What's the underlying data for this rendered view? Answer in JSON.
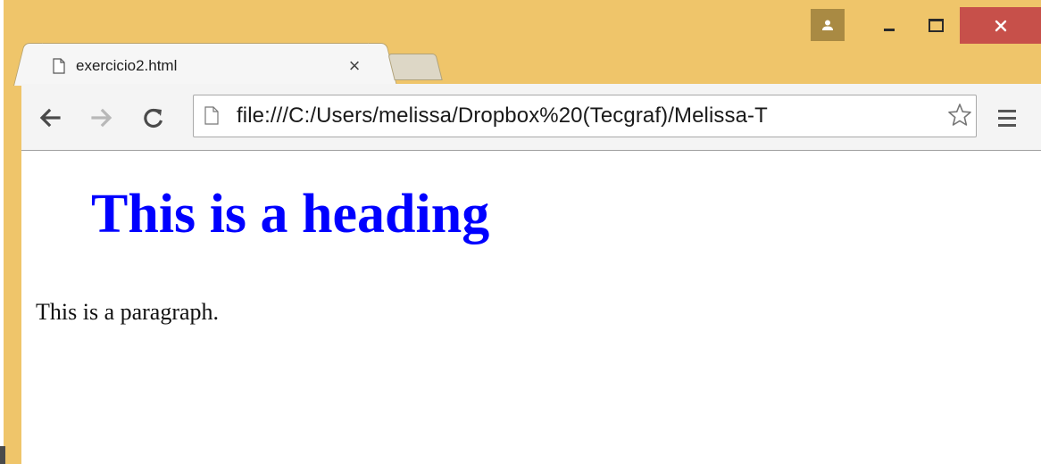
{
  "window": {
    "controls": {
      "profile_icon": "person-icon",
      "minimize_icon": "minimize-icon",
      "maximize_icon": "maximize-icon",
      "close_icon": "close-icon"
    },
    "colors": {
      "frame": "#efc56a",
      "close_button": "#c7504a",
      "profile_button": "#a98a43"
    }
  },
  "tabs": [
    {
      "title": "exercicio2.html",
      "icon": "page-icon",
      "close_glyph": "×",
      "active": true
    }
  ],
  "toolbar": {
    "back_icon": "back-arrow-icon",
    "forward_icon": "forward-arrow-icon",
    "reload_icon": "reload-icon",
    "url": "file:///C:/Users/melissa/Dropbox%20(Tecgraf)/Melissa-T",
    "bookmark_icon": "star-icon",
    "menu_icon": "hamburger-menu-icon"
  },
  "page": {
    "heading": "This is a heading",
    "heading_color": "#0000ff",
    "paragraph": "This is a paragraph."
  }
}
